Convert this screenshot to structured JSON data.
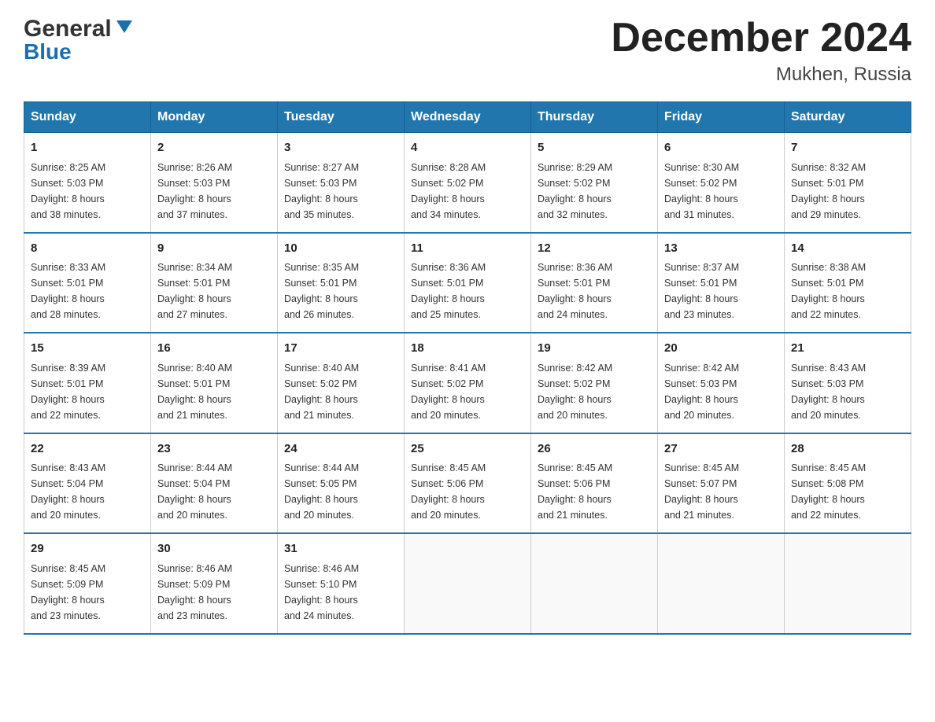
{
  "header": {
    "logo_general": "General",
    "logo_blue": "Blue",
    "month_title": "December 2024",
    "location": "Mukhen, Russia"
  },
  "days_of_week": [
    "Sunday",
    "Monday",
    "Tuesday",
    "Wednesday",
    "Thursday",
    "Friday",
    "Saturday"
  ],
  "weeks": [
    [
      {
        "day": "1",
        "sunrise": "8:25 AM",
        "sunset": "5:03 PM",
        "daylight": "8 hours and 38 minutes."
      },
      {
        "day": "2",
        "sunrise": "8:26 AM",
        "sunset": "5:03 PM",
        "daylight": "8 hours and 37 minutes."
      },
      {
        "day": "3",
        "sunrise": "8:27 AM",
        "sunset": "5:03 PM",
        "daylight": "8 hours and 35 minutes."
      },
      {
        "day": "4",
        "sunrise": "8:28 AM",
        "sunset": "5:02 PM",
        "daylight": "8 hours and 34 minutes."
      },
      {
        "day": "5",
        "sunrise": "8:29 AM",
        "sunset": "5:02 PM",
        "daylight": "8 hours and 32 minutes."
      },
      {
        "day": "6",
        "sunrise": "8:30 AM",
        "sunset": "5:02 PM",
        "daylight": "8 hours and 31 minutes."
      },
      {
        "day": "7",
        "sunrise": "8:32 AM",
        "sunset": "5:01 PM",
        "daylight": "8 hours and 29 minutes."
      }
    ],
    [
      {
        "day": "8",
        "sunrise": "8:33 AM",
        "sunset": "5:01 PM",
        "daylight": "8 hours and 28 minutes."
      },
      {
        "day": "9",
        "sunrise": "8:34 AM",
        "sunset": "5:01 PM",
        "daylight": "8 hours and 27 minutes."
      },
      {
        "day": "10",
        "sunrise": "8:35 AM",
        "sunset": "5:01 PM",
        "daylight": "8 hours and 26 minutes."
      },
      {
        "day": "11",
        "sunrise": "8:36 AM",
        "sunset": "5:01 PM",
        "daylight": "8 hours and 25 minutes."
      },
      {
        "day": "12",
        "sunrise": "8:36 AM",
        "sunset": "5:01 PM",
        "daylight": "8 hours and 24 minutes."
      },
      {
        "day": "13",
        "sunrise": "8:37 AM",
        "sunset": "5:01 PM",
        "daylight": "8 hours and 23 minutes."
      },
      {
        "day": "14",
        "sunrise": "8:38 AM",
        "sunset": "5:01 PM",
        "daylight": "8 hours and 22 minutes."
      }
    ],
    [
      {
        "day": "15",
        "sunrise": "8:39 AM",
        "sunset": "5:01 PM",
        "daylight": "8 hours and 22 minutes."
      },
      {
        "day": "16",
        "sunrise": "8:40 AM",
        "sunset": "5:01 PM",
        "daylight": "8 hours and 21 minutes."
      },
      {
        "day": "17",
        "sunrise": "8:40 AM",
        "sunset": "5:02 PM",
        "daylight": "8 hours and 21 minutes."
      },
      {
        "day": "18",
        "sunrise": "8:41 AM",
        "sunset": "5:02 PM",
        "daylight": "8 hours and 20 minutes."
      },
      {
        "day": "19",
        "sunrise": "8:42 AM",
        "sunset": "5:02 PM",
        "daylight": "8 hours and 20 minutes."
      },
      {
        "day": "20",
        "sunrise": "8:42 AM",
        "sunset": "5:03 PM",
        "daylight": "8 hours and 20 minutes."
      },
      {
        "day": "21",
        "sunrise": "8:43 AM",
        "sunset": "5:03 PM",
        "daylight": "8 hours and 20 minutes."
      }
    ],
    [
      {
        "day": "22",
        "sunrise": "8:43 AM",
        "sunset": "5:04 PM",
        "daylight": "8 hours and 20 minutes."
      },
      {
        "day": "23",
        "sunrise": "8:44 AM",
        "sunset": "5:04 PM",
        "daylight": "8 hours and 20 minutes."
      },
      {
        "day": "24",
        "sunrise": "8:44 AM",
        "sunset": "5:05 PM",
        "daylight": "8 hours and 20 minutes."
      },
      {
        "day": "25",
        "sunrise": "8:45 AM",
        "sunset": "5:06 PM",
        "daylight": "8 hours and 20 minutes."
      },
      {
        "day": "26",
        "sunrise": "8:45 AM",
        "sunset": "5:06 PM",
        "daylight": "8 hours and 21 minutes."
      },
      {
        "day": "27",
        "sunrise": "8:45 AM",
        "sunset": "5:07 PM",
        "daylight": "8 hours and 21 minutes."
      },
      {
        "day": "28",
        "sunrise": "8:45 AM",
        "sunset": "5:08 PM",
        "daylight": "8 hours and 22 minutes."
      }
    ],
    [
      {
        "day": "29",
        "sunrise": "8:45 AM",
        "sunset": "5:09 PM",
        "daylight": "8 hours and 23 minutes."
      },
      {
        "day": "30",
        "sunrise": "8:46 AM",
        "sunset": "5:09 PM",
        "daylight": "8 hours and 23 minutes."
      },
      {
        "day": "31",
        "sunrise": "8:46 AM",
        "sunset": "5:10 PM",
        "daylight": "8 hours and 24 minutes."
      },
      null,
      null,
      null,
      null
    ]
  ],
  "labels": {
    "sunrise": "Sunrise:",
    "sunset": "Sunset:",
    "daylight": "Daylight:"
  }
}
